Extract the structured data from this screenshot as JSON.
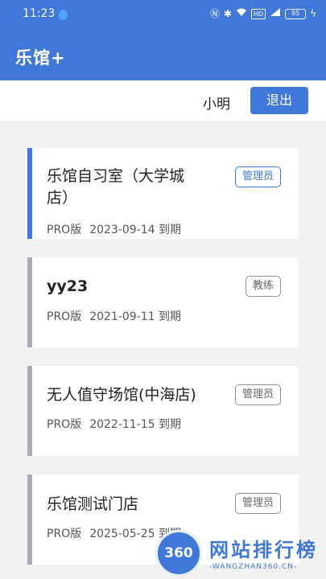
{
  "status_bar": {
    "time": "11:23",
    "hd_label": "HD",
    "battery": "95"
  },
  "app_bar": {
    "title": "乐馆+"
  },
  "user_bar": {
    "username": "小明",
    "logout_label": "退出"
  },
  "venues": [
    {
      "name_line1": "乐馆自习室（大学城",
      "name_line2": "店）",
      "role": "管理员",
      "edition": "PRO版",
      "expiry": "2023-09-14 到期"
    },
    {
      "name_line1": "yy23",
      "role": "教练",
      "edition": "PRO版",
      "expiry": "2021-09-11 到期"
    },
    {
      "name_line1": "无人值守场馆(中海店)",
      "role": "管理员",
      "edition": "PRO版",
      "expiry": "2022-11-15 到期"
    },
    {
      "name_line1": "乐馆测试门店",
      "role": "管理员",
      "edition": "PRO版",
      "expiry": "2025-05-25 到期"
    }
  ],
  "watermark": {
    "logo": "360",
    "text": "网站排行榜",
    "sub": "-WANGZHAN360.CN-"
  },
  "colors": {
    "primary": "#3f78d9",
    "card_bar_inactive": "#a6adb8",
    "background": "#f2f2f2"
  }
}
